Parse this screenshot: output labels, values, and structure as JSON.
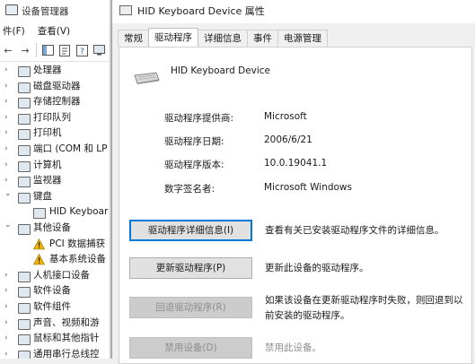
{
  "device_manager": {
    "title": "设备管理器",
    "menu": [
      "件(F)",
      "查看(V)"
    ],
    "tree": [
      {
        "label": "处理器",
        "icon": "cpu-icon"
      },
      {
        "label": "磁盘驱动器",
        "icon": "disk-icon"
      },
      {
        "label": "存储控制器",
        "icon": "storage-icon"
      },
      {
        "label": "打印队列",
        "icon": "printer-icon"
      },
      {
        "label": "打印机",
        "icon": "printer-icon"
      },
      {
        "label": "端口 (COM 和 LP",
        "icon": "port-icon"
      },
      {
        "label": "计算机",
        "icon": "computer-icon"
      },
      {
        "label": "监视器",
        "icon": "monitor-icon"
      },
      {
        "label": "键盘",
        "icon": "keyboard-icon",
        "expanded": true
      },
      {
        "label": "HID Keyboar",
        "icon": "keyboard-icon",
        "child": true
      },
      {
        "label": "其他设备",
        "icon": "other-device-icon",
        "expanded": true
      },
      {
        "label": "PCI 数据捕获",
        "icon": "warning-device-icon",
        "child": true
      },
      {
        "label": "基本系统设备",
        "icon": "warning-device-icon",
        "child": true
      },
      {
        "label": "人机接口设备",
        "icon": "hid-icon"
      },
      {
        "label": "软件设备",
        "icon": "software-icon"
      },
      {
        "label": "软件组件",
        "icon": "software-icon"
      },
      {
        "label": "声音、视频和游",
        "icon": "sound-icon"
      },
      {
        "label": "鼠标和其他指针",
        "icon": "mouse-icon"
      },
      {
        "label": "通用串行总线控",
        "icon": "usb-icon"
      }
    ]
  },
  "dialog": {
    "title": "HID Keyboard Device 属性",
    "tabs": [
      "常规",
      "驱动程序",
      "详细信息",
      "事件",
      "电源管理"
    ],
    "active_tab": "驱动程序",
    "device_name": "HID Keyboard Device",
    "properties": [
      {
        "key": "驱动程序提供商:",
        "value": "Microsoft"
      },
      {
        "key": "驱动程序日期:",
        "value": "2006/6/21"
      },
      {
        "key": "驱动程序版本:",
        "value": "10.0.19041.1"
      },
      {
        "key": "数字签名者:",
        "value": "Microsoft Windows"
      }
    ],
    "buttons": [
      {
        "label": "驱动程序详细信息(I)",
        "desc": "查看有关已安装驱动程序文件的详细信息。",
        "enabled": true,
        "focused": true
      },
      {
        "label": "更新驱动程序(P)",
        "desc": "更新此设备的驱动程序。",
        "enabled": true
      },
      {
        "label": "回退驱动程序(R)",
        "desc": "如果该设备在更新驱动程序时失败，则回退到以前安装的驱动程序。",
        "enabled": false
      },
      {
        "label": "禁用设备(D)",
        "desc": "禁用此设备。",
        "enabled": false
      }
    ]
  },
  "colors": {
    "focus": "#0078d7",
    "disabled_text": "#8d8d8d",
    "warning": "#f2b600"
  }
}
